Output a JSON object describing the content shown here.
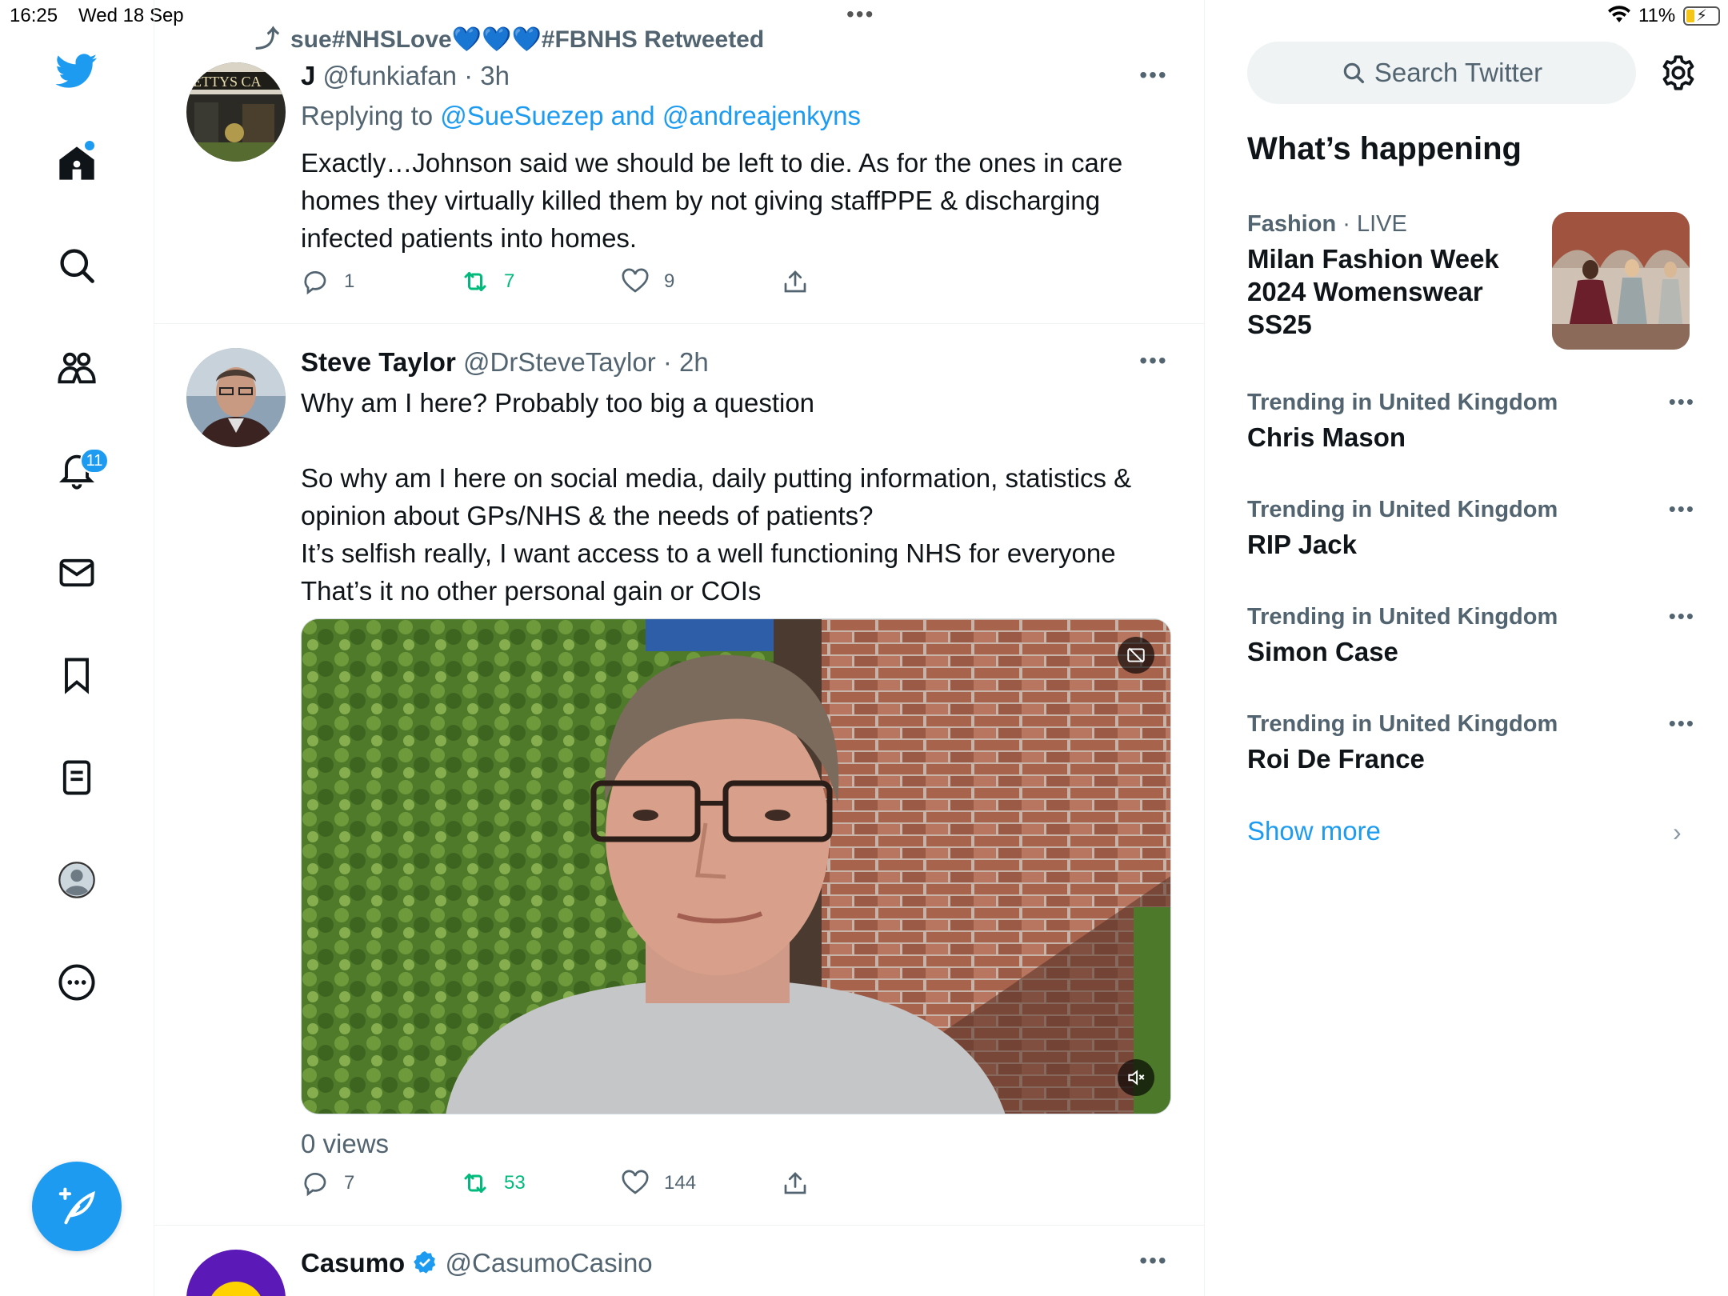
{
  "status_bar": {
    "time": "16:25",
    "date": "Wed 18 Sep",
    "battery": "11%"
  },
  "nav": {
    "notifications_badge": "11"
  },
  "colors": {
    "accent": "#1d9bf0",
    "retweet": "#00ba7c",
    "secondary_text": "#536471"
  },
  "feed": {
    "tweet1": {
      "retweet_banner": "sue#NHSLove💙💙💙#FBNHS Retweeted",
      "name": "J",
      "handle": "@funkiafan",
      "time": "· 3h",
      "replying_prefix": "Replying to",
      "replying_to": "@SueSuezep and @andreajenkyns",
      "text_lines": [
        "Exactly…Johnson said we should be left to die. As for the ones in care",
        "homes they virtually killed them by not giving staffPPE  & discharging",
        "infected patients into homes."
      ],
      "replies": "1",
      "retweets": "7",
      "likes": "9"
    },
    "tweet2": {
      "name": "Steve Taylor",
      "handle": "@DrSteveTaylor",
      "time": "· 2h",
      "text_lines": [
        "Why am I here? Probably too big a question",
        "",
        "So why am I here on social media, daily putting information, statistics &",
        "opinion about GPs/NHS & the needs of patients?",
        "It’s selfish really, I want access to a well functioning NHS for everyone",
        "That’s it no other personal gain or COIs"
      ],
      "views": "0 views",
      "replies": "7",
      "retweets": "53",
      "likes": "144"
    },
    "tweet3": {
      "name": "Casumo",
      "handle": "@CasumoCasino"
    }
  },
  "sidebar": {
    "search_placeholder": "Search Twitter",
    "title": "What’s happening",
    "trends": [
      {
        "category": "Fashion",
        "live": "· LIVE",
        "title_lines": [
          "Milan Fashion Week",
          "2024 Womenswear",
          "SS25"
        ]
      },
      {
        "category": "Trending in United Kingdom",
        "title": "Chris Mason"
      },
      {
        "category": "Trending in United Kingdom",
        "title": "RIP Jack"
      },
      {
        "category": "Trending in United Kingdom",
        "title": "Simon Case"
      },
      {
        "category": "Trending in United Kingdom",
        "title": "Roi De France"
      }
    ],
    "show_more": "Show more"
  }
}
